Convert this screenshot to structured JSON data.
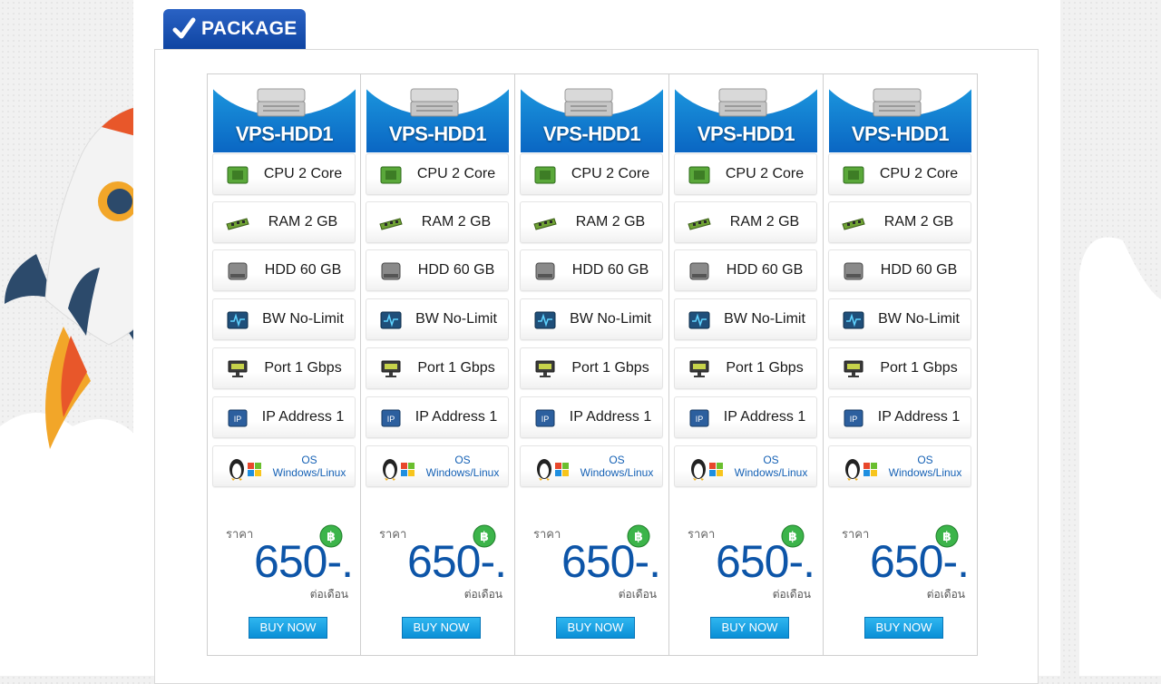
{
  "header": {
    "tab_title": "PACKAGE"
  },
  "packages": [
    {
      "name": "VPS-HDD1",
      "cpu": "CPU  2 Core",
      "ram": "RAM 2 GB",
      "hdd": "HDD 60 GB",
      "bw": "BW No-Limit",
      "port": "Port 1 Gbps",
      "ip": "IP Address 1",
      "os_title": "OS",
      "os_value": "Windows/Linux",
      "price_label": "ราคา",
      "price": "650-.",
      "per": "ต่อเดือน",
      "buy": "BUY NOW"
    },
    {
      "name": "VPS-HDD1",
      "cpu": "CPU  2 Core",
      "ram": "RAM 2 GB",
      "hdd": "HDD 60 GB",
      "bw": "BW No-Limit",
      "port": "Port 1 Gbps",
      "ip": "IP Address 1",
      "os_title": "OS",
      "os_value": "Windows/Linux",
      "price_label": "ราคา",
      "price": "650-.",
      "per": "ต่อเดือน",
      "buy": "BUY NOW"
    },
    {
      "name": "VPS-HDD1",
      "cpu": "CPU  2 Core",
      "ram": "RAM 2 GB",
      "hdd": "HDD 60 GB",
      "bw": "BW No-Limit",
      "port": "Port 1 Gbps",
      "ip": "IP Address 1",
      "os_title": "OS",
      "os_value": "Windows/Linux",
      "price_label": "ราคา",
      "price": "650-.",
      "per": "ต่อเดือน",
      "buy": "BUY NOW"
    },
    {
      "name": "VPS-HDD1",
      "cpu": "CPU  2 Core",
      "ram": "RAM 2 GB",
      "hdd": "HDD 60 GB",
      "bw": "BW No-Limit",
      "port": "Port 1 Gbps",
      "ip": "IP Address 1",
      "os_title": "OS",
      "os_value": "Windows/Linux",
      "price_label": "ราคา",
      "price": "650-.",
      "per": "ต่อเดือน",
      "buy": "BUY NOW"
    },
    {
      "name": "VPS-HDD1",
      "cpu": "CPU  2 Core",
      "ram": "RAM 2 GB",
      "hdd": "HDD 60 GB",
      "bw": "BW No-Limit",
      "port": "Port 1 Gbps",
      "ip": "IP Address 1",
      "os_title": "OS",
      "os_value": "Windows/Linux",
      "price_label": "ราคา",
      "price": "650-.",
      "per": "ต่อเดือน",
      "buy": "BUY NOW"
    }
  ],
  "colors": {
    "brand_blue": "#0f45a2",
    "header_blue": "#0a66c3",
    "button_blue": "#0a8fd6",
    "price_blue": "#0d55a8"
  },
  "icons": {
    "tab": "checkmark-icon",
    "header": "server-icon",
    "cpu": "cpu-chip-icon",
    "ram": "ram-module-icon",
    "hdd": "hard-drive-icon",
    "bw": "bandwidth-monitor-icon",
    "port": "network-port-icon",
    "ip": "ip-address-icon",
    "os": "linux-windows-logos-icon",
    "currency": "baht-coin-icon"
  }
}
